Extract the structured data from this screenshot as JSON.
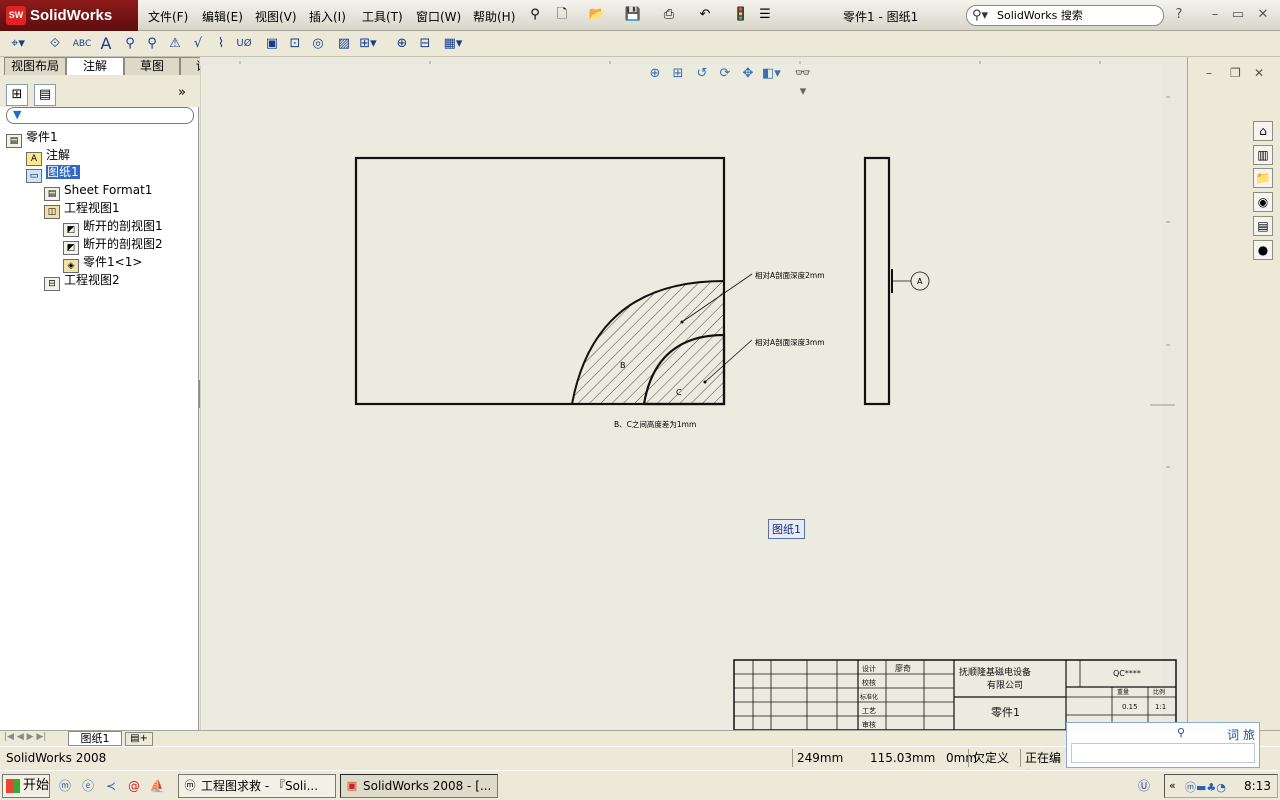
{
  "app": {
    "logo": "SolidWorks",
    "window_title": "零件1 - 图纸1"
  },
  "menu": [
    "文件(F)",
    "编辑(E)",
    "视图(V)",
    "插入(I)",
    "工具(T)",
    "窗口(W)",
    "帮助(H)"
  ],
  "search": {
    "placeholder": "SolidWorks 搜索"
  },
  "command_tabs": [
    "视图布局",
    "注解",
    "草图",
    "评估"
  ],
  "command_tabs_active": "注解",
  "command_toolbar_icons": [
    "smart-dimension-icon",
    "model-items-icon",
    "spell-checker-icon",
    "note-icon",
    "balloon-icon",
    "auto-balloon-icon",
    "datum-target-icon",
    "surface-finish-icon",
    "weld-symbol-icon",
    "hole-callout-icon",
    "gtol-icon",
    "datum-feature-icon",
    "datum-target-icon",
    "hatch-icon",
    "block-icon",
    "centermark-icon",
    "centerline-icon",
    "table-icon"
  ],
  "tree": {
    "root": "零件1",
    "items": [
      {
        "label": "注解",
        "icon": "annotations-icon"
      },
      {
        "label": "图纸1",
        "icon": "sheet-icon",
        "selected": true
      },
      {
        "label": "Sheet Format1",
        "icon": "sheet-format-icon"
      },
      {
        "label": "工程视图1",
        "icon": "drawing-view-icon"
      },
      {
        "label": "断开的剖视图1",
        "icon": "broken-out-section-icon"
      },
      {
        "label": "断开的剖视图2",
        "icon": "broken-out-section-icon"
      },
      {
        "label": "零件1<1>",
        "icon": "part-icon"
      },
      {
        "label": "工程视图2",
        "icon": "drawing-view-icon"
      }
    ]
  },
  "drawing": {
    "note1": "相对A剖面深度2mm",
    "note2": "相对A剖面深度3mm",
    "note3": "B、C之间高度差为1mm",
    "label_b": "B",
    "label_c": "C",
    "datum": "A",
    "sheet_label": "图纸1",
    "title_block": {
      "company": "抚顺隆基磁电设备",
      "company2": "有限公司",
      "part": "零件1",
      "drawing_no": "QC****",
      "designer_label": "设计",
      "designer_value": "廖奇",
      "check": "校核",
      "std": "标准化",
      "craft": "工艺",
      "approve": "审核",
      "weight_label": "重量",
      "scale_label": "比例",
      "weight": "0.15",
      "scale": "1:1"
    }
  },
  "sheet_tab": "图纸1",
  "status": {
    "app": "SolidWorks 2008",
    "x": "249mm",
    "y": "115.03mm",
    "z": "0mm",
    "state": "欠定义",
    "mode": "正在编辑"
  },
  "ime": {
    "label": "词 旅"
  },
  "taskbar": {
    "start": "开始",
    "tasks": [
      "工程图求救 - 『Soli...",
      "SolidWorks 2008 - [..."
    ],
    "clock": "8:13"
  }
}
